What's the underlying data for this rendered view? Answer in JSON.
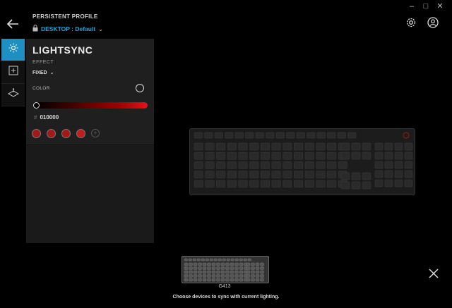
{
  "header": {
    "profile_label": "PERSISTENT PROFILE",
    "profile_value": "DESKTOP : Default"
  },
  "sidebar": {
    "items": [
      {
        "name": "lighting",
        "icon": "sun-icon",
        "active": true
      },
      {
        "name": "assignments",
        "icon": "plus-square-icon",
        "active": false
      },
      {
        "name": "game-mode",
        "icon": "joystick-icon",
        "active": false
      }
    ]
  },
  "panel": {
    "title": "LIGHTSYNC",
    "effect_label": "EFFECT",
    "effect_value": "FIXED",
    "color_label": "COLOR",
    "hex_prefix": "#",
    "hex_value": "010000",
    "accent": "#1e8fc2",
    "swatch_color": "#a01a1a"
  },
  "device": {
    "name": "G413",
    "sync_text": "Choose devices to sync with current lighting."
  }
}
